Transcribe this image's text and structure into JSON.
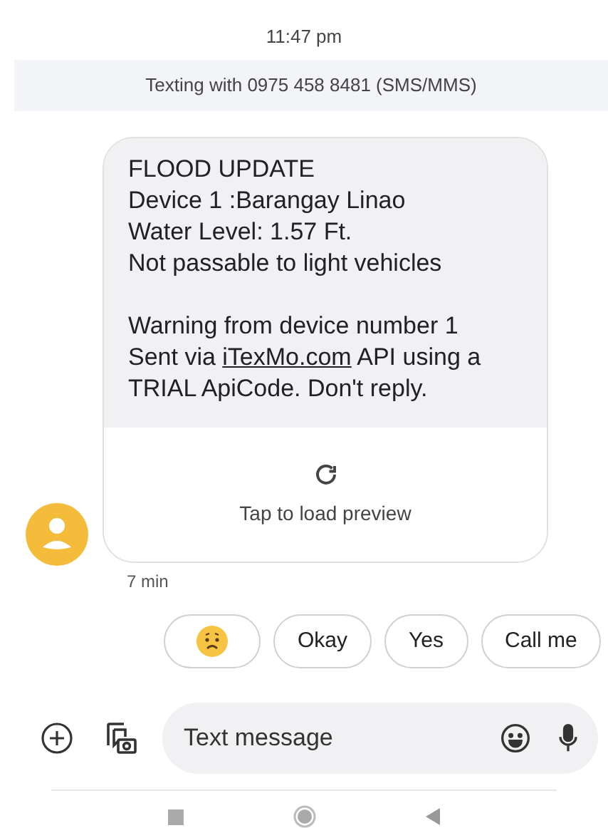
{
  "timestamp": "11:47 pm",
  "banner": "Texting with 0975 458 8481 (SMS/MMS)",
  "message": {
    "lines": [
      "FLOOD UPDATE",
      "Device 1 :Barangay Linao",
      "Water Level: 1.57 Ft.",
      "Not passable to light vehicles"
    ],
    "warning": "Warning from device number 1",
    "sent_before": "Sent via ",
    "link": "iTexMo.com",
    "sent_after": " API using a",
    "last_line": "TRIAL ApiCode. Don't reply.",
    "preview": "Tap to load preview",
    "time": "7 min"
  },
  "suggestions": [
    {
      "kind": "emoji"
    },
    {
      "kind": "text",
      "label": "Okay"
    },
    {
      "kind": "text",
      "label": "Yes"
    },
    {
      "kind": "text",
      "label": "Call me"
    }
  ],
  "composer": {
    "placeholder": "Text message"
  }
}
